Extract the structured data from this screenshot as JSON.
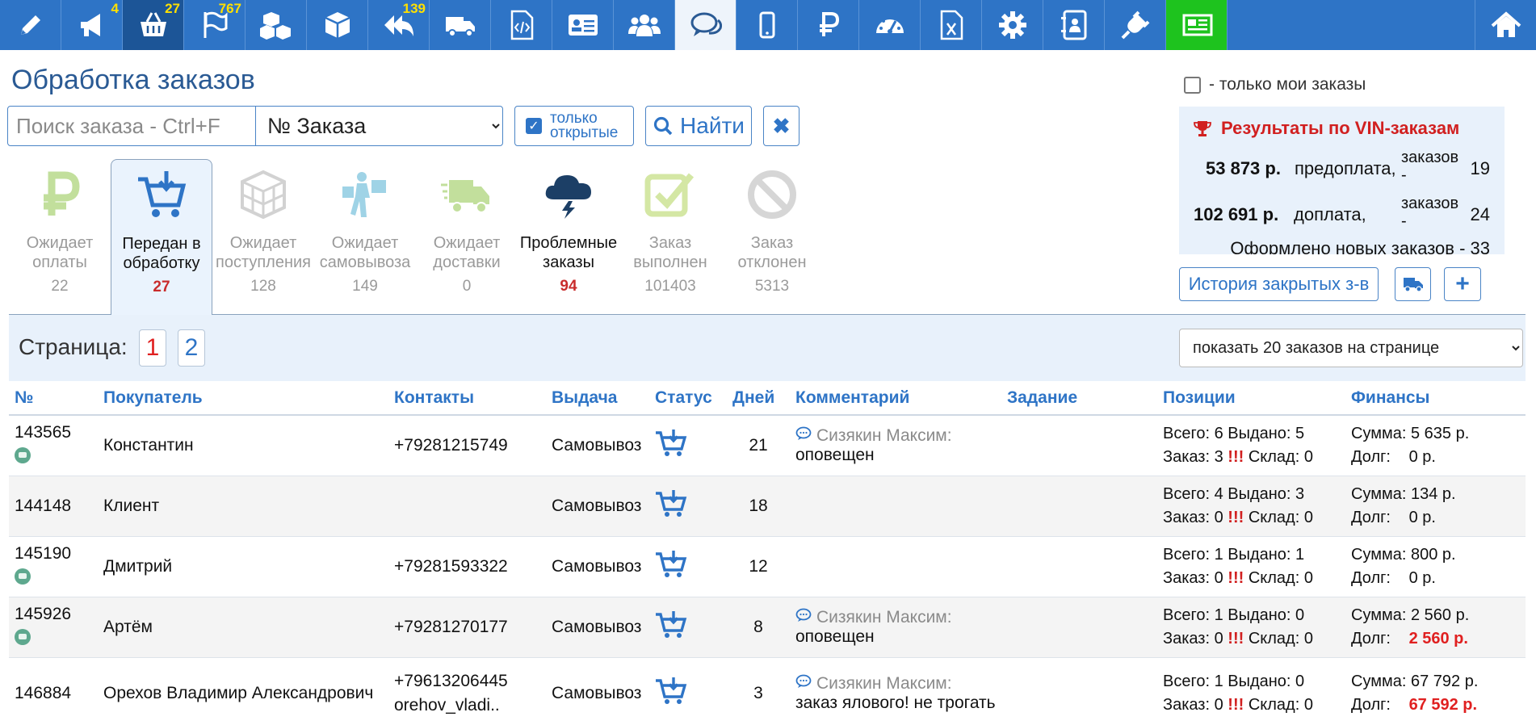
{
  "nav": {
    "badges": {
      "promo": "4",
      "cart": "27",
      "flags": "767",
      "returns": "139"
    }
  },
  "title": "Обработка заказов",
  "search": {
    "placeholder": "Поиск заказа - Ctrl+F",
    "type_selected": "№ Заказа",
    "only_open_line1": "только",
    "only_open_line2": "открытые",
    "find_label": "Найти"
  },
  "right": {
    "only_mine_label": "- только мои заказы",
    "vin_title": "Результаты по VIN-заказам",
    "vin_rows": [
      {
        "amount": "53 873 р.",
        "kind": "предоплата,",
        "label1": "заказов",
        "label2": "-",
        "count": "19"
      },
      {
        "amount": "102 691 р.",
        "kind": "доплата,",
        "label1": "заказов",
        "label2": "-",
        "count": "24"
      }
    ],
    "vin_new": "Оформлено новых заказов - 33",
    "history_label": "История закрытых з-в"
  },
  "status_tabs": [
    {
      "line1": "Ожидает",
      "line2": "оплаты",
      "count": "22",
      "icon": "ruble-icon",
      "color": "#c2df9c"
    },
    {
      "line1": "Передан в",
      "line2": "обработку",
      "count": "27",
      "icon": "cart-icon",
      "color": "#2e74c6"
    },
    {
      "line1": "Ожидает",
      "line2": "поступления",
      "count": "128",
      "icon": "boxes-icon",
      "color": "#d2d2d2"
    },
    {
      "line1": "Ожидает",
      "line2": "самовывоза",
      "count": "149",
      "icon": "person-bags-icon",
      "color": "#9fd3e6"
    },
    {
      "line1": "Ожидает",
      "line2": "доставки",
      "count": "0",
      "icon": "truck-icon",
      "color": "#c2df9c"
    },
    {
      "line1": "Проблемные",
      "line2": "заказы",
      "count": "94",
      "icon": "storm-icon",
      "color": "#1c3f66"
    },
    {
      "line1": "Заказ",
      "line2": "выполнен",
      "count": "101403",
      "icon": "check-icon",
      "color": "#d4e7a4"
    },
    {
      "line1": "Заказ",
      "line2": "отклонен",
      "count": "5313",
      "icon": "ban-icon",
      "color": "#d6d6d6"
    }
  ],
  "pagination": {
    "label": "Страница:",
    "pages": [
      "1",
      "2"
    ],
    "per_page": "показать 20 заказов на странице"
  },
  "table": {
    "headers": [
      "№",
      "Покупатель",
      "Контакты",
      "Выдача",
      "Статус",
      "Дней",
      "Комментарий",
      "Задание",
      "Позиции",
      "Финансы"
    ],
    "pos_labels": {
      "total": "Всего:",
      "issued": "Выдано:",
      "order": "Заказ:",
      "excl": "!!!",
      "stock": "Склад:"
    },
    "fin_labels": {
      "sum": "Сумма:",
      "debt": "Долг:"
    },
    "rows": [
      {
        "id": "143565",
        "buyer": "Константин",
        "contact": "+79281215749",
        "contact2": "",
        "delivery": "Самовывоз",
        "days": "21",
        "comment_author": "Сизякин Максим:",
        "comment_text": "оповещен",
        "task": "",
        "total": "6",
        "issued": "5",
        "order": "3",
        "stock": "0",
        "sum": "5 635 р.",
        "debt": "0 р."
      },
      {
        "id": "144148",
        "buyer": "Клиент",
        "contact": "",
        "contact2": "",
        "delivery": "Самовывоз",
        "days": "18",
        "comment_author": "",
        "comment_text": "",
        "task": "",
        "total": "4",
        "issued": "3",
        "order": "0",
        "stock": "0",
        "sum": "134 р.",
        "debt": "0 р."
      },
      {
        "id": "145190",
        "buyer": "Дмитрий",
        "contact": "+79281593322",
        "contact2": "",
        "delivery": "Самовывоз",
        "days": "12",
        "comment_author": "",
        "comment_text": "",
        "task": "",
        "total": "1",
        "issued": "1",
        "order": "0",
        "stock": "0",
        "sum": "800 р.",
        "debt": "0 р."
      },
      {
        "id": "145926",
        "buyer": "Артём",
        "contact": "+79281270177",
        "contact2": "",
        "delivery": "Самовывоз",
        "days": "8",
        "comment_author": "Сизякин Максим:",
        "comment_text": "оповещен",
        "task": "",
        "total": "1",
        "issued": "0",
        "order": "0",
        "stock": "0",
        "sum": "2 560 р.",
        "debt": "2 560 р."
      },
      {
        "id": "146884",
        "buyer": "Орехов Владимир Александрович",
        "contact": "+79613206445",
        "contact2": "orehov_vladi..",
        "delivery": "Самовывоз",
        "days": "3",
        "comment_author": "Сизякин Максим:",
        "comment_text": "заказ ялового! не трогать",
        "task": "",
        "total": "1",
        "issued": "0",
        "order": "0",
        "stock": "0",
        "sum": "67 792 р.",
        "debt": "67 592 р."
      }
    ]
  }
}
